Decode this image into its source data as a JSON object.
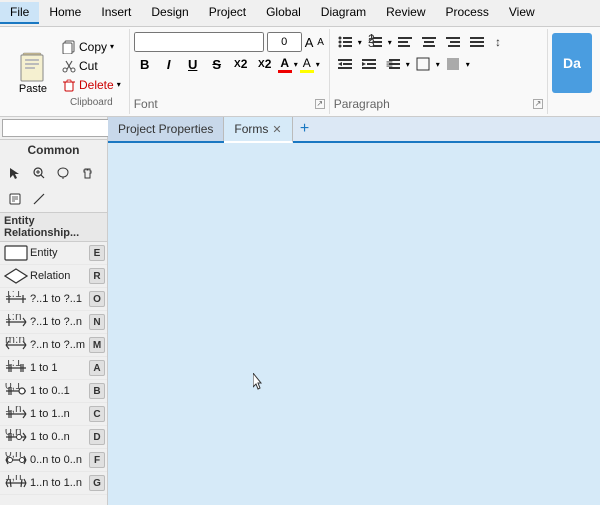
{
  "menu": {
    "items": [
      "File",
      "Home",
      "Insert",
      "Design",
      "Project",
      "Global",
      "Diagram",
      "Review",
      "Process",
      "View"
    ]
  },
  "ribbon": {
    "clipboard": {
      "paste_label": "Paste",
      "copy_label": "Copy",
      "cut_label": "Cut",
      "delete_label": "Delete",
      "group_label": "Clipboard"
    },
    "font": {
      "font_name": "",
      "font_size": "0",
      "group_label": "Font"
    },
    "paragraph": {
      "group_label": "Paragraph"
    },
    "da_label": "Da"
  },
  "left_panel": {
    "search_placeholder": "",
    "common_label": "Common",
    "entity_relationship_label": "Entity Relationship...",
    "er_items": [
      {
        "label": "Entity",
        "key": "E"
      },
      {
        "label": "Relation",
        "key": "R"
      },
      {
        "label": "?..1 to ?..1",
        "key": "O"
      },
      {
        "label": "?..1 to ?..n",
        "key": "N"
      },
      {
        "label": "?..n to ?..m",
        "key": "M"
      },
      {
        "label": "1 to 1",
        "key": "A"
      },
      {
        "label": "1 to 0..1",
        "key": "B"
      },
      {
        "label": "1 to 1..n",
        "key": "C"
      },
      {
        "label": "1 to 0..n",
        "key": "D"
      },
      {
        "label": "0..n to 0..n",
        "key": "F"
      },
      {
        "label": "1..n to 1..n",
        "key": "G"
      }
    ],
    "er_item_prefixes": [
      "1:1",
      "1:n",
      "m:n",
      "1:1",
      "0,1",
      "1,n",
      "0,n",
      "0,n",
      "0,n"
    ]
  },
  "tabs": [
    {
      "label": "Project Properties",
      "active": false,
      "closable": false
    },
    {
      "label": "Forms",
      "active": true,
      "closable": true
    }
  ],
  "canvas": {
    "background": "#d6eaf8"
  }
}
